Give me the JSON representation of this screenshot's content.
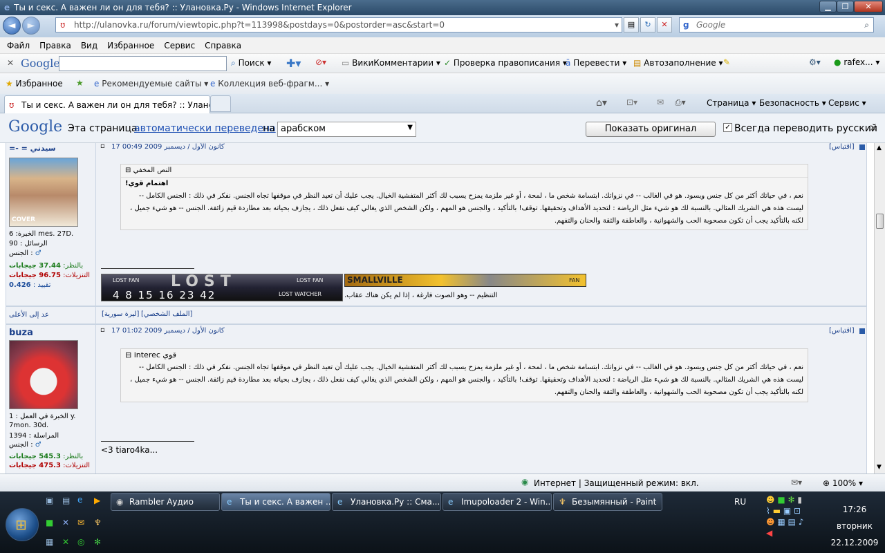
{
  "window": {
    "title": "Ты и секс. А важен ли он для тебя? :: Улановка.Ру - Windows Internet Explorer",
    "btn_min": "▁",
    "btn_max": "❐",
    "btn_close": "✕"
  },
  "nav": {
    "url": "http://ulanovka.ru/forum/viewtopic.php?t=113998&postdays=0&postorder=asc&start=0",
    "search_placeholder": "Google",
    "back": "◄",
    "fwd": "►",
    "search_go": "⌕"
  },
  "menu": [
    "Файл",
    "Правка",
    "Вид",
    "Избранное",
    "Сервис",
    "Справка"
  ],
  "gtoolbar": {
    "close": "✕",
    "brand": "Google",
    "search_btn": "Поиск",
    "wiki": "ВикиКомментарии",
    "spell": "Проверка правописания",
    "translate": "Перевести",
    "autofill": "Автозаполнение",
    "user": "rafex..."
  },
  "favbar": {
    "favorites": "Избранное",
    "recommended": "Рекомендуемые сайты",
    "gallery": "Коллекция веб-фрагм..."
  },
  "tab": {
    "title": "Ты и секс. А важен ли он для тебя? :: Уланoвка...",
    "cmd_page": "Страница",
    "cmd_safety": "Безопасность",
    "cmd_tools": "Сервис"
  },
  "translate": {
    "brand": "Google",
    "prefix": "Эта страница",
    "link": "автоматически переведена",
    "on": "на",
    "language": "арабском",
    "show_original": "Показать оригинал",
    "always": "Всегда переводить русский",
    "close": "✕"
  },
  "post1": {
    "author": "=- = سيدني",
    "date": "17 كانون الأول / ديسمبر 2009 00:49",
    "quote_btn": "[اقتباس]",
    "quote_title": "النص المخفي",
    "quote_author": "اهتمام قوي!",
    "quote_body": "نعم ، في حياتك أكثر من كل جنس ويسود. هو في الغالب -- في نزواتك. ابتسامة شخص ما ، لمحة ، أو غير ملزمة يمزح يسبب لك أكثر المتفشية الخيال. يجب عليك أن تعيد النظر في موقفها تجاه الجنس. نفكر في ذلك : الجنس الكامل -- ليست هذه هي الشريك المثالي. بالنسبة لك هو شيء مثل الرياضة : لتحديد الأهداف وتحقيقها. توقف! بالتأكيد ، والجنس هو المهم ، ولكن الشخص الذي يغالي كيف نفعل ذلك ، يجازف بحياته بعد مطاردة قيم زائفة. الجنس -- هو شيء جميل ، لكنه بالتأكيد يجب أن تكون مصحوبة الحب والشهوانية ، والعاطفة والثقة والحنان والتفهم.",
    "exp": "الخبرة: 6 mes. 27D.",
    "msgs": "الرسائل : 90",
    "gender": "الجنس :",
    "rep_plus_label": "بالنظر:",
    "rep_plus": "37.44 جيجابات",
    "rep_upload_label": "التنزيلات:",
    "rep_upload": "96.75 جيجابات",
    "ratio_label": "تقييد :",
    "ratio": "0.426",
    "lost_fan_l": "LOST FAN",
    "lost_fan_r": "LOST FAN",
    "lost_logo": "LOST",
    "lost_numbers": "4 8 15 16 23 42",
    "lost_watcher": "LOST WATCHER",
    "smallville": "SMALLVILLE",
    "smallville_fan": "FAN",
    "sig_text": "التنظيم -- وهو الصوت فارغة ، إذا لم يكن هناك عقاب.",
    "back_top": "عد إلى الأعلى",
    "profile": "[الملف الشخصي]",
    "pm": "[ليرة سورية]",
    "avatar_caption": "COVER"
  },
  "post2": {
    "author": "buza",
    "date": "17 كانون الأول / ديسمبر 2009 01:02",
    "quote_btn": "[اقتباس]",
    "quote_title": "interec قوي",
    "quote_body": "نعم ، في حياتك أكثر من كل جنس ويسود. هو في الغالب -- في نزواتك. ابتسامة شخص ما ، لمحة ، أو غير ملزمة يمزح يسبب لك أكثر المتفشية الخيال. يجب عليك أن تعيد النظر في موقفها تجاه الجنس. نفكر في ذلك : الجنس الكامل -- ليست هذه هي الشريك المثالي. بالنسبة لك هو شيء مثل الرياضة : لتحديد الأهداف وتحقيقها. توقف! بالتأكيد ، والجنس هو المهم ، ولكن الشخص الذي يغالي كيف نفعل ذلك ، يجازف بحياته بعد مطاردة قيم زائفة. الجنس -- هو شيء جميل ، لكنه بالتأكيد يجب أن تكون مصحوبة الحب والشهوانية ، والعاطفة والثقة والحنان والتفهم.",
    "exp": "الخبرة في العمل : 1 y. 7mon. 30d.",
    "msgs": "المراسلة : 1394",
    "gender": "الجنس :",
    "rep_plus_label": "بالنظر:",
    "rep_plus": "545.3 جيجابات",
    "rep_upload_label": "التنزيلات:",
    "rep_upload": "475.3 جيجابات",
    "sig_text": "<3 tiaro4ka..."
  },
  "status": {
    "zone": "Интернет | Защищенный режим: вкл.",
    "zoom": "100%"
  },
  "taskbar": {
    "items": [
      "Rambler Аудио",
      "Ты и секс. А важен ...",
      "Улановка.Ру :: Сма...",
      "Imupoloader 2 - Win...",
      "Безымянный - Paint"
    ],
    "lang": "RU",
    "time": "17:26",
    "day": "вторник",
    "date": "22.12.2009"
  }
}
